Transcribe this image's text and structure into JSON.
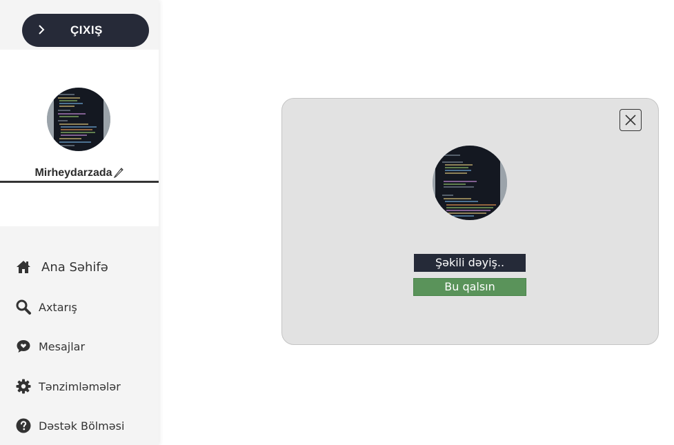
{
  "sidebar": {
    "logout_label": "ÇIXIŞ",
    "username": "Mirheydarzada",
    "items": [
      {
        "label": "Ana Səhifə",
        "icon": "home-icon"
      },
      {
        "label": "Axtarış",
        "icon": "search-icon"
      },
      {
        "label": "Mesajlar",
        "icon": "message-icon"
      },
      {
        "label": "Tənzimləmələr",
        "icon": "gear-icon"
      },
      {
        "label": "Dəstək Bölməsi",
        "icon": "help-icon"
      }
    ]
  },
  "modal": {
    "change_label": "Şəkili dəyiş..",
    "keep_label": "Bu qalsın"
  },
  "colors": {
    "dark": "#262a38",
    "green": "#5a935a",
    "modal_bg": "#e2e2e2",
    "sidebar_bg": "#f4f4f4"
  }
}
